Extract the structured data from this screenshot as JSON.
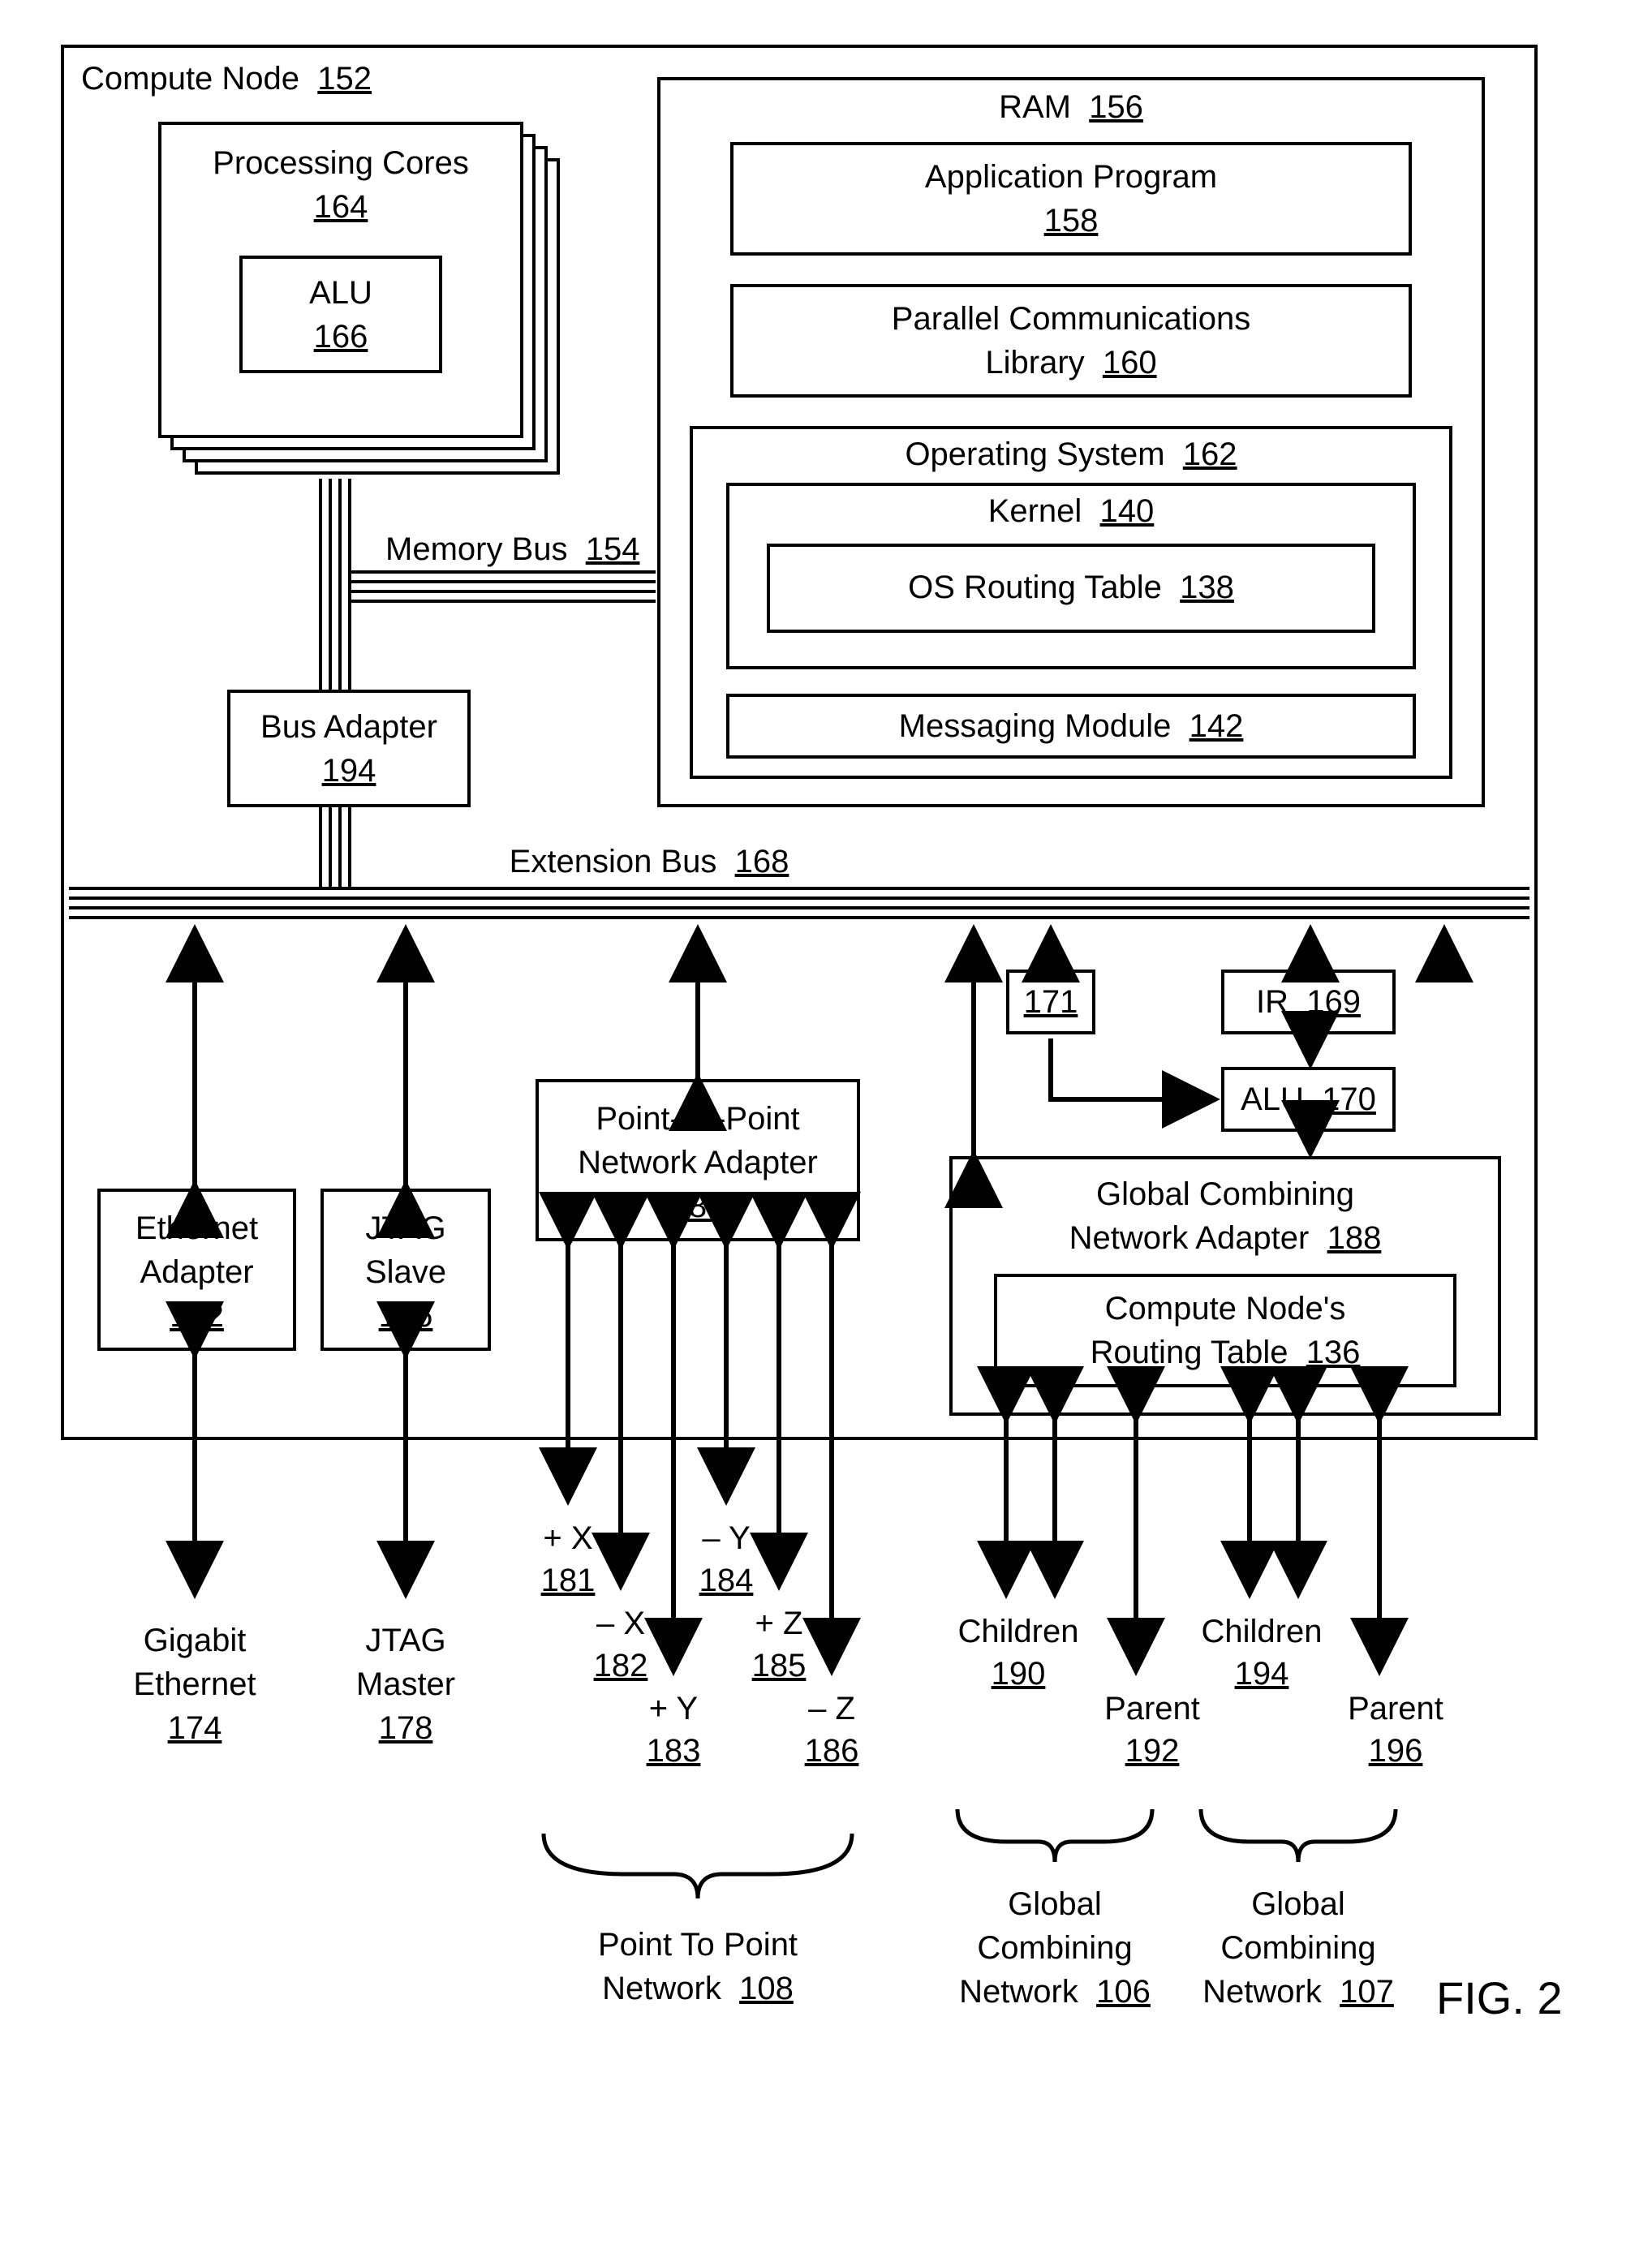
{
  "compute_node": {
    "label": "Compute Node",
    "ref": "152"
  },
  "processing_cores": {
    "label": "Processing Cores",
    "ref": "164"
  },
  "alu_core": {
    "label": "ALU",
    "ref": "166"
  },
  "ram": {
    "label": "RAM",
    "ref": "156"
  },
  "app_program": {
    "label": "Application Program",
    "ref": "158"
  },
  "pcl": {
    "label1": "Parallel Communications",
    "label2": "Library",
    "ref": "160"
  },
  "os": {
    "label": "Operating System",
    "ref": "162"
  },
  "kernel": {
    "label": "Kernel",
    "ref": "140"
  },
  "os_routing": {
    "label": "OS Routing Table",
    "ref": "138"
  },
  "msg_module": {
    "label": "Messaging Module",
    "ref": "142"
  },
  "memory_bus": {
    "label": "Memory Bus",
    "ref": "154"
  },
  "bus_adapter": {
    "label": "Bus Adapter",
    "ref": "194"
  },
  "extension_bus": {
    "label": "Extension Bus",
    "ref": "168"
  },
  "ethernet_adapter": {
    "label1": "Ethernet",
    "label2": "Adapter",
    "ref": "172"
  },
  "jtag_slave": {
    "label1": "JTAG",
    "label2": "Slave",
    "ref": "176"
  },
  "p2p_adapter": {
    "label1": "Point-To-Point",
    "label2": "Network Adapter",
    "ref": "180"
  },
  "gcn_adapter": {
    "label1": "Global Combining",
    "label2": "Network Adapter",
    "ref": "188"
  },
  "cn_routing": {
    "label1": "Compute Node's",
    "label2": "Routing Table",
    "ref": "136"
  },
  "reg171": {
    "ref": "171"
  },
  "ir": {
    "label": "IR",
    "ref": "169"
  },
  "alu170": {
    "label": "ALU",
    "ref": "170"
  },
  "gigabit": {
    "label1": "Gigabit",
    "label2": "Ethernet",
    "ref": "174"
  },
  "jtag_master": {
    "label1": "JTAG",
    "label2": "Master",
    "ref": "178"
  },
  "p2p_network": {
    "label1": "Point To Point",
    "label2": "Network",
    "ref": "108"
  },
  "gcn1": {
    "label1": "Global",
    "label2": "Combining",
    "label3": "Network",
    "ref": "106"
  },
  "gcn2": {
    "label1": "Global",
    "label2": "Combining",
    "label3": "Network",
    "ref": "107"
  },
  "plus_x": {
    "label": "+ X",
    "ref": "181"
  },
  "minus_x": {
    "label": "– X",
    "ref": "182"
  },
  "plus_y": {
    "label": "+ Y",
    "ref": "183"
  },
  "minus_y": {
    "label": "– Y",
    "ref": "184"
  },
  "plus_z": {
    "label": "+ Z",
    "ref": "185"
  },
  "minus_z": {
    "label": "– Z",
    "ref": "186"
  },
  "children1": {
    "label": "Children",
    "ref": "190"
  },
  "parent1": {
    "label": "Parent",
    "ref": "192"
  },
  "children2": {
    "label": "Children",
    "ref": "194"
  },
  "parent2": {
    "label": "Parent",
    "ref": "196"
  },
  "fig": "FIG. 2"
}
